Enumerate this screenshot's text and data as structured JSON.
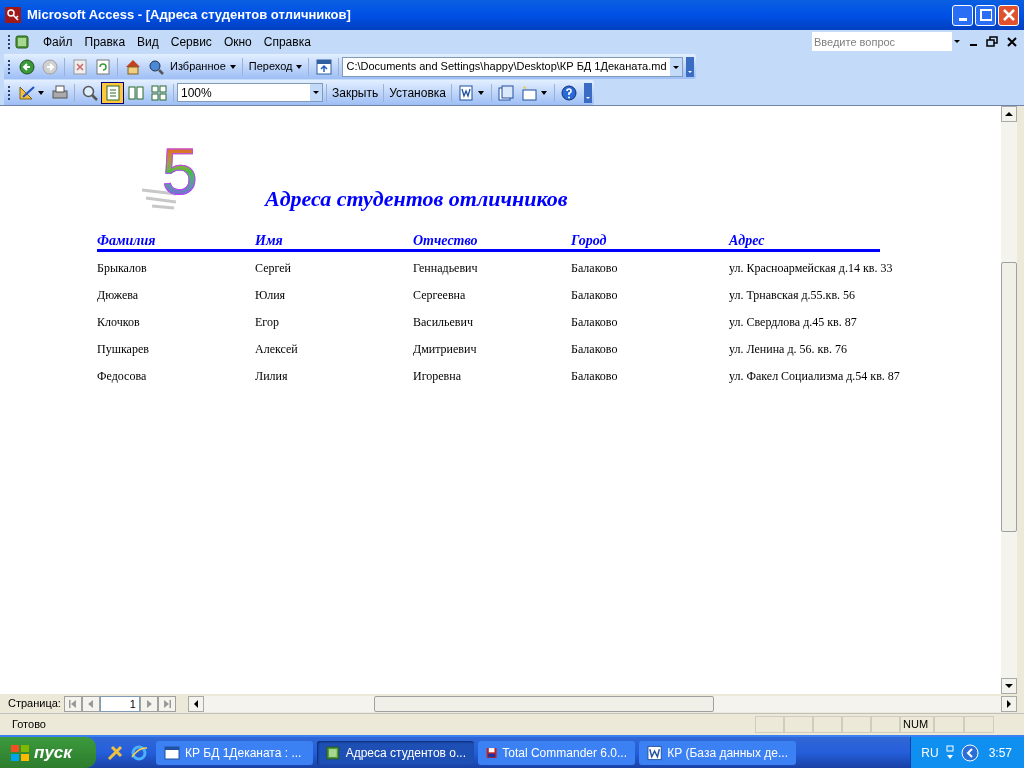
{
  "window": {
    "title": "Microsoft Access - [Адреса студентов отличников]"
  },
  "menu": [
    "Файл",
    "Правка",
    "Вид",
    "Сервис",
    "Окно",
    "Справка"
  ],
  "help_box": {
    "placeholder": "Введите вопрос"
  },
  "web_toolbar": {
    "favorites": "Избранное",
    "go": "Переход",
    "address": "C:\\Documents and Settings\\happy\\Desktop\\КР БД 1Деканата.md"
  },
  "preview_toolbar": {
    "zoom": "100%",
    "close": "Закрыть",
    "setup": "Установка",
    "views": [
      {
        "kind": "one",
        "selected": true
      },
      {
        "kind": "two",
        "selected": false
      },
      {
        "kind": "multi",
        "selected": false
      }
    ]
  },
  "report": {
    "logo": "5",
    "title": "Адреса студентов отличников",
    "columns": [
      "Фамилия",
      "Имя",
      "Отчество",
      "Город",
      "Адрес"
    ],
    "rows": [
      [
        "Брыкалов",
        "Сергей",
        "Геннадьевич",
        "Балаково",
        "ул. Красноармейская д.14 кв. 33"
      ],
      [
        "Дюжева",
        "Юлия",
        "Сергеевна",
        "Балаково",
        "ул. Трнавская д.55.кв. 56"
      ],
      [
        "Клочков",
        "Егор",
        "Васильевич",
        "Балаково",
        "ул. Свердлова д.45 кв. 87"
      ],
      [
        "Пушкарев",
        "Алексей",
        "Дмитриевич",
        "Балаково",
        "ул. Ленина д. 56. кв. 76"
      ],
      [
        "Федосова",
        "Лилия",
        "Игоревна",
        "Балаково",
        "ул. Факел Социализма д.54 кв. 87"
      ]
    ]
  },
  "page_nav": {
    "label": "Страница:",
    "page": "1"
  },
  "status_bar": {
    "text": "Готово",
    "indicator": "NUM"
  },
  "taskbar": {
    "start": "пуск",
    "tasks": [
      {
        "label": "КР БД 1Деканата : ...",
        "selected": false
      },
      {
        "label": "Адреса студентов о...",
        "selected": true
      },
      {
        "label": "Total Commander 6.0...",
        "selected": false
      },
      {
        "label": "КР (База данных де...",
        "selected": false
      }
    ],
    "language": "RU",
    "clock": "3:57"
  }
}
